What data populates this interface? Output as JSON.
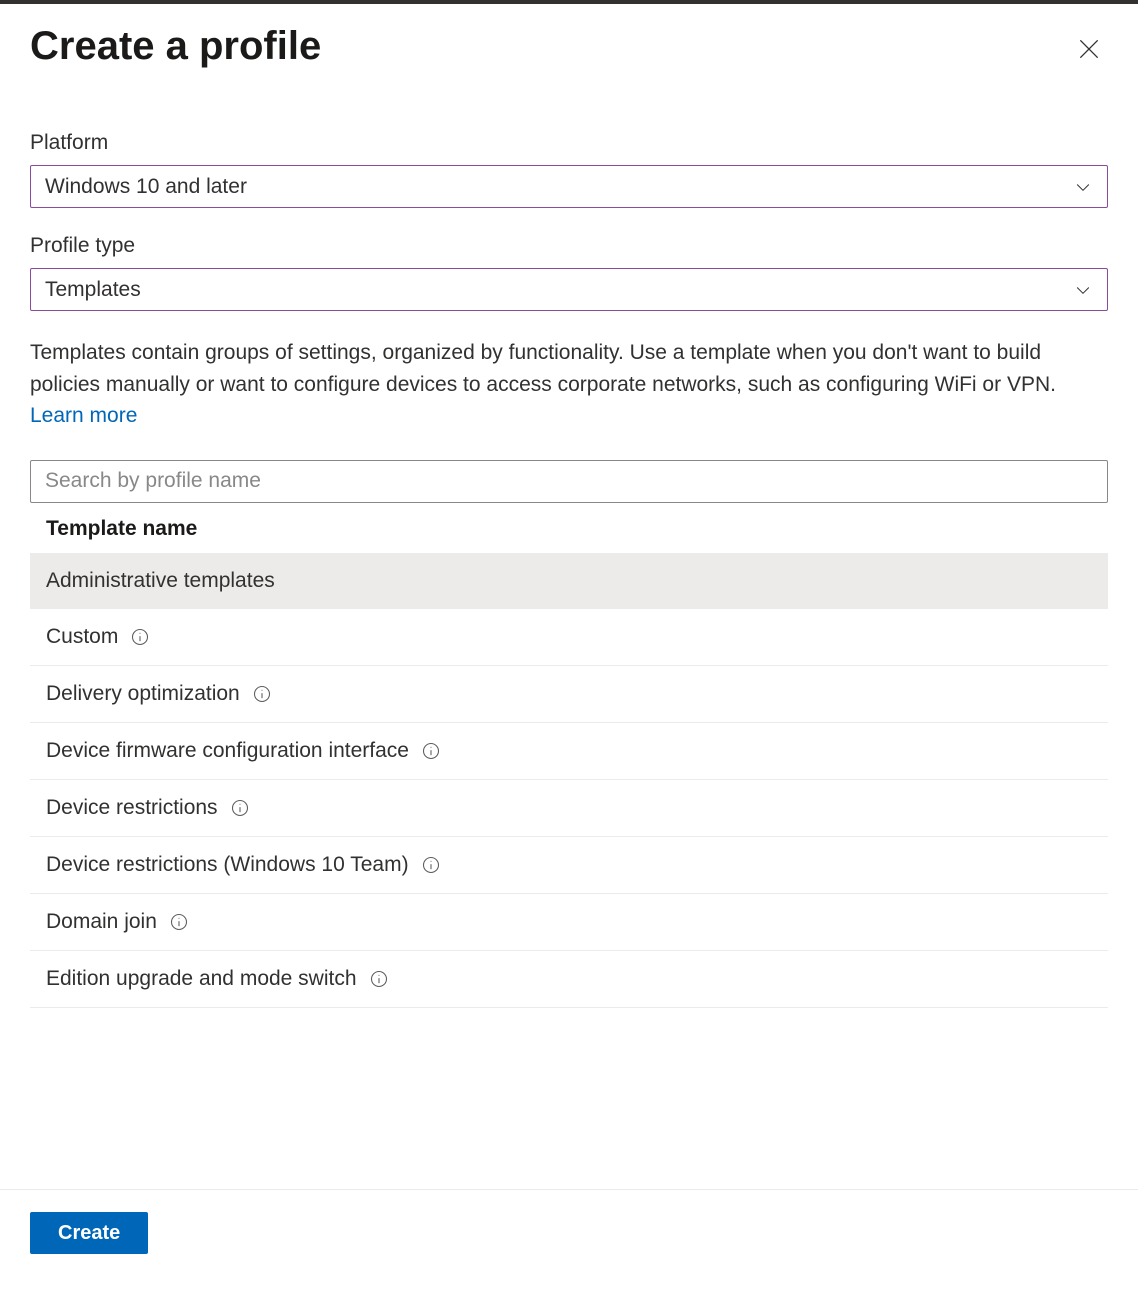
{
  "header": {
    "title": "Create a profile"
  },
  "fields": {
    "platform": {
      "label": "Platform",
      "value": "Windows 10 and later"
    },
    "profile_type": {
      "label": "Profile type",
      "value": "Templates"
    }
  },
  "description": {
    "text": "Templates contain groups of settings, organized by functionality. Use a template when you don't want to build policies manually or want to configure devices to access corporate networks, such as configuring WiFi or VPN. ",
    "link": "Learn more"
  },
  "search": {
    "placeholder": "Search by profile name"
  },
  "table": {
    "header": "Template name",
    "rows": [
      {
        "label": "Administrative templates",
        "selected": true,
        "info": false
      },
      {
        "label": "Custom",
        "selected": false,
        "info": true
      },
      {
        "label": "Delivery optimization",
        "selected": false,
        "info": true
      },
      {
        "label": "Device firmware configuration interface",
        "selected": false,
        "info": true
      },
      {
        "label": "Device restrictions",
        "selected": false,
        "info": true
      },
      {
        "label": "Device restrictions (Windows 10 Team)",
        "selected": false,
        "info": true
      },
      {
        "label": "Domain join",
        "selected": false,
        "info": true
      },
      {
        "label": "Edition upgrade and mode switch",
        "selected": false,
        "info": true
      }
    ]
  },
  "footer": {
    "create_label": "Create"
  }
}
